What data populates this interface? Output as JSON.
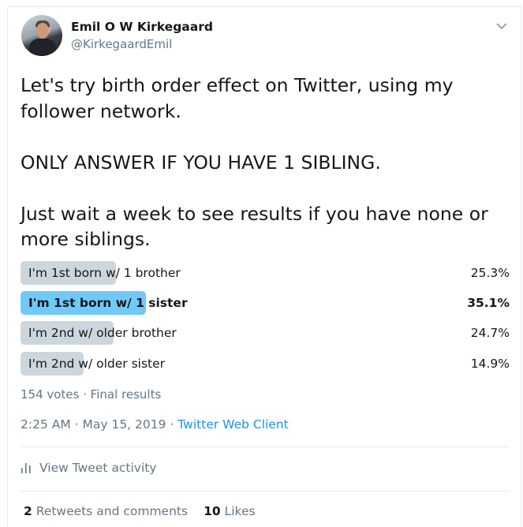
{
  "author": {
    "name": "Emil O W Kirkegaard",
    "handle": "@KirkegaardEmil"
  },
  "tweet": {
    "text": "Let's try birth order effect on Twitter, using my follower network.\n\nONLY ANSWER IF YOU HAVE 1 SIBLING.\n\nJust wait a week to see results if you have none or more siblings."
  },
  "poll": {
    "options": [
      {
        "label": "I'm 1st born w/ 1 brother",
        "percent": "25.3%",
        "fraction": 0.253,
        "winner": false
      },
      {
        "label": "I'm 1st born w/ 1 sister",
        "percent": "35.1%",
        "fraction": 0.351,
        "winner": true
      },
      {
        "label": "I'm 2nd w/ older brother",
        "percent": "24.7%",
        "fraction": 0.247,
        "winner": false
      },
      {
        "label": "I'm 2nd w/ older sister",
        "percent": "14.9%",
        "fraction": 0.149,
        "winner": false
      }
    ],
    "votes_text": "154 votes · Final results"
  },
  "timestamp": "2:25 AM · May 15, 2019",
  "separator": " · ",
  "client": "Twitter Web Client",
  "activity_label": "View Tweet activity",
  "stats": {
    "retweets_count": "2",
    "retweets_label": "Retweets and comments",
    "likes_count": "10",
    "likes_label": "Likes"
  },
  "colors": {
    "bar": "#ccd6dd",
    "bar_winner": "#71c9f8",
    "link": "#1b95e0",
    "muted": "#657786"
  },
  "icons": [
    "chevron-down-icon",
    "bar-chart-icon"
  ]
}
